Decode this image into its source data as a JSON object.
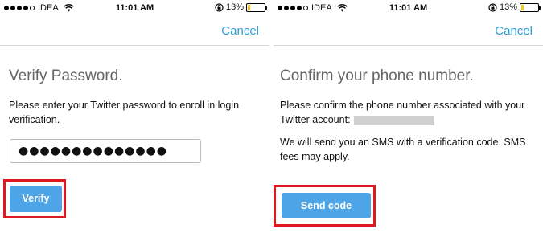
{
  "left_screen": {
    "status": {
      "carrier": "IDEA",
      "time": "11:01 AM",
      "battery": "13%",
      "battery_level": 0.13,
      "signal_bars": 4
    },
    "nav": {
      "cancel_label": "Cancel"
    },
    "title": "Verify Password.",
    "description": "Please enter your Twitter password to enroll in login verification.",
    "password_value": "●●●●●●●●●●●●●●",
    "verify_label": "Verify"
  },
  "right_screen": {
    "status": {
      "carrier": "IDEA",
      "time": "11:01 AM",
      "battery": "13%",
      "battery_level": 0.13,
      "signal_bars": 4
    },
    "nav": {
      "cancel_label": "Cancel"
    },
    "title": "Confirm your phone number.",
    "description": "Please confirm the phone number associated with your Twitter account:",
    "sms_note": "We will send you an SMS with a verification code. SMS fees may apply.",
    "send_label": "Send code"
  },
  "colors": {
    "accent": "#2a9fd8",
    "button": "#4da4e6",
    "highlight": "#e0191e",
    "battery": "#f5c518"
  }
}
